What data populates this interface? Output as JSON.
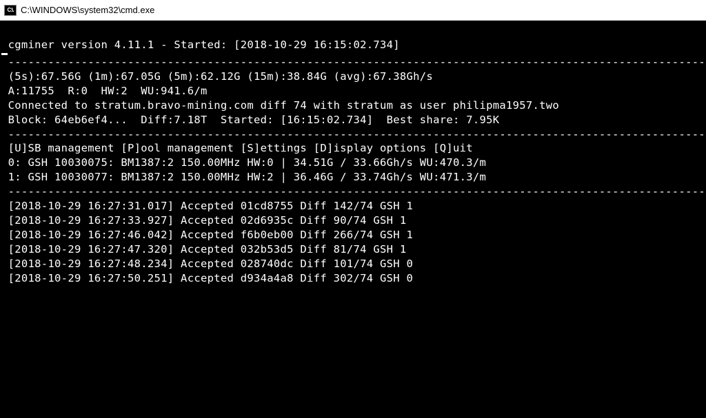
{
  "titlebar": {
    "path": " C:\\WINDOWS\\system32\\cmd.exe",
    "icon_label": "C:\\."
  },
  "header": {
    "version_line": " cgminer version 4.11.1 - Started: [2018-10-29 16:15:02.734]",
    "sep": " ------------------------------------------------------------------------------------------------------------"
  },
  "summary": {
    "line1": " (5s):67.56G (1m):67.05G (5m):62.12G (15m):38.84G (avg):67.38Gh/s",
    "line2": " A:11755  R:0  HW:2  WU:941.6/m",
    "line3": " Connected to stratum.bravo-mining.com diff 74 with stratum as user philipma1957.two",
    "line4": " Block: 64eb6ef4...  Diff:7.18T  Started: [16:15:02.734]  Best share: 7.95K"
  },
  "menu": " [U]SB management [P]ool management [S]ettings [D]isplay options [Q]uit",
  "devices": [
    " 0: GSH 10030075: BM1387:2 150.00MHz HW:0 | 34.51G / 33.66Gh/s WU:470.3/m",
    " 1: GSH 10030077: BM1387:2 150.00MHz HW:2 | 36.46G / 33.74Gh/s WU:471.3/m"
  ],
  "log": [
    " [2018-10-29 16:27:31.017] Accepted 01cd8755 Diff 142/74 GSH 1",
    " [2018-10-29 16:27:33.927] Accepted 02d6935c Diff 90/74 GSH 1",
    " [2018-10-29 16:27:46.042] Accepted f6b0eb00 Diff 266/74 GSH 1",
    " [2018-10-29 16:27:47.320] Accepted 032b53d5 Diff 81/74 GSH 1",
    " [2018-10-29 16:27:48.234] Accepted 028740dc Diff 101/74 GSH 0",
    " [2018-10-29 16:27:50.251] Accepted d934a4a8 Diff 302/74 GSH 0"
  ]
}
